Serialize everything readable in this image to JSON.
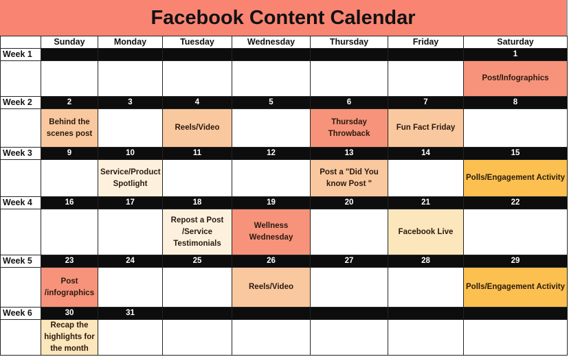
{
  "title": "Facebook Content Calendar",
  "days": [
    "Sunday",
    "Monday",
    "Tuesday",
    "Wednesday",
    "Thursday",
    "Friday",
    "Saturday"
  ],
  "colors": {
    "title_bg": "#fa8472",
    "salmon": "#f7937a",
    "peach": "#f9c89e",
    "cream": "#fdf1de",
    "light_yellow": "#fce6bb",
    "gold": "#fbc04f",
    "date_bar": "#0d0d0d"
  },
  "weeks": [
    {
      "label": "Week 1",
      "dates": [
        "",
        "",
        "",
        "",
        "",
        "",
        "1"
      ],
      "content": [
        {
          "text": "",
          "color": "none"
        },
        {
          "text": "",
          "color": "none"
        },
        {
          "text": "",
          "color": "none"
        },
        {
          "text": "",
          "color": "none"
        },
        {
          "text": "",
          "color": "none"
        },
        {
          "text": "",
          "color": "none"
        },
        {
          "text": "Post/Infographics",
          "color": "salmon"
        }
      ]
    },
    {
      "label": "Week 2",
      "dates": [
        "2",
        "3",
        "4",
        "5",
        "6",
        "7",
        "8"
      ],
      "content": [
        {
          "text": "Behind the scenes post",
          "color": "peach"
        },
        {
          "text": "",
          "color": "none"
        },
        {
          "text": "Reels/Video",
          "color": "peach"
        },
        {
          "text": "",
          "color": "none"
        },
        {
          "text": "Thursday Throwback",
          "color": "salmon"
        },
        {
          "text": "Fun Fact Friday",
          "color": "peach"
        },
        {
          "text": "",
          "color": "none"
        }
      ]
    },
    {
      "label": "Week 3",
      "dates": [
        "9",
        "10",
        "11",
        "12",
        "13",
        "14",
        "15"
      ],
      "content": [
        {
          "text": "",
          "color": "none"
        },
        {
          "text": "Service/Product Spotlight",
          "color": "cream"
        },
        {
          "text": "",
          "color": "none"
        },
        {
          "text": "",
          "color": "none"
        },
        {
          "text": "Post a \"Did You know Post \"",
          "color": "peach"
        },
        {
          "text": "",
          "color": "none"
        },
        {
          "text": "Polls/Engagement Activity",
          "color": "gold"
        }
      ]
    },
    {
      "label": "Week 4",
      "dates": [
        "16",
        "17",
        "18",
        "19",
        "20",
        "21",
        "22"
      ],
      "content": [
        {
          "text": "",
          "color": "none"
        },
        {
          "text": "",
          "color": "none"
        },
        {
          "text": "Repost a Post /Service Testimonials",
          "color": "cream"
        },
        {
          "text": "Wellness Wednesday",
          "color": "salmon"
        },
        {
          "text": "",
          "color": "none"
        },
        {
          "text": "Facebook Live",
          "color": "lightyellow"
        },
        {
          "text": "",
          "color": "none"
        }
      ]
    },
    {
      "label": "Week 5",
      "dates": [
        "23",
        "24",
        "25",
        "26",
        "27",
        "28",
        "29"
      ],
      "content": [
        {
          "text": "Post /infographics",
          "color": "salmon"
        },
        {
          "text": "",
          "color": "none"
        },
        {
          "text": "",
          "color": "none"
        },
        {
          "text": "Reels/Video",
          "color": "peach"
        },
        {
          "text": "",
          "color": "none"
        },
        {
          "text": "",
          "color": "none"
        },
        {
          "text": "Polls/Engagement Activity",
          "color": "gold"
        }
      ]
    },
    {
      "label": "Week 6",
      "dates": [
        "30",
        "31",
        "",
        "",
        "",
        "",
        ""
      ],
      "content": [
        {
          "text": "Recap the highlights for the month",
          "color": "lightyellow"
        },
        {
          "text": "",
          "color": "none"
        },
        {
          "text": "",
          "color": "none"
        },
        {
          "text": "",
          "color": "none"
        },
        {
          "text": "",
          "color": "none"
        },
        {
          "text": "",
          "color": "none"
        },
        {
          "text": "",
          "color": "none"
        }
      ]
    }
  ]
}
